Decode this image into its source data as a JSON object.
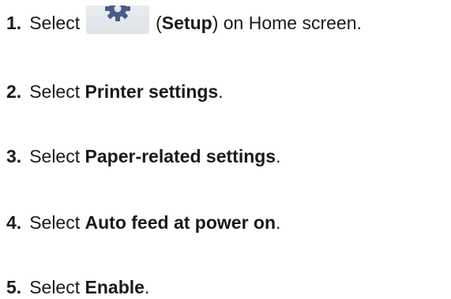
{
  "steps": [
    {
      "number": "1.",
      "before": "Select",
      "icon": "gear-icon",
      "paren_open": "(",
      "bold": "Setup",
      "after": ") on Home screen."
    },
    {
      "number": "2.",
      "before": "Select",
      "bold": "Printer settings",
      "after": "."
    },
    {
      "number": "3.",
      "before": "Select",
      "bold": "Paper-related settings",
      "after": "."
    },
    {
      "number": "4.",
      "before": "Select",
      "bold": "Auto feed at power on",
      "after": "."
    },
    {
      "number": "5.",
      "before": "Select",
      "bold": "Enable",
      "after": "."
    }
  ],
  "colors": {
    "text": "#1a1a1a",
    "icon_gear": "#4a5a8c",
    "icon_background": "#e4e8ec"
  }
}
